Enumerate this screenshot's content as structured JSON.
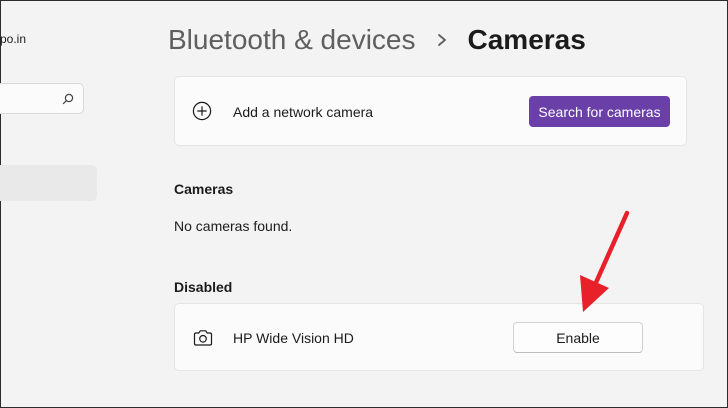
{
  "sidebar": {
    "account_email": "po.in",
    "search": {
      "placeholder": ""
    }
  },
  "header": {
    "breadcrumb_parent": "Bluetooth & devices",
    "breadcrumb_current": "Cameras"
  },
  "network_camera": {
    "label": "Add a network camera",
    "button_label": "Search for cameras"
  },
  "cameras_section": {
    "title": "Cameras",
    "empty_text": "No cameras found."
  },
  "disabled_section": {
    "title": "Disabled",
    "items": [
      {
        "name": "HP Wide Vision HD",
        "button_label": "Enable",
        "icon": "camera-icon"
      }
    ]
  },
  "colors": {
    "accent": "#6a3fa8",
    "annotation_arrow": "#e8202a"
  }
}
